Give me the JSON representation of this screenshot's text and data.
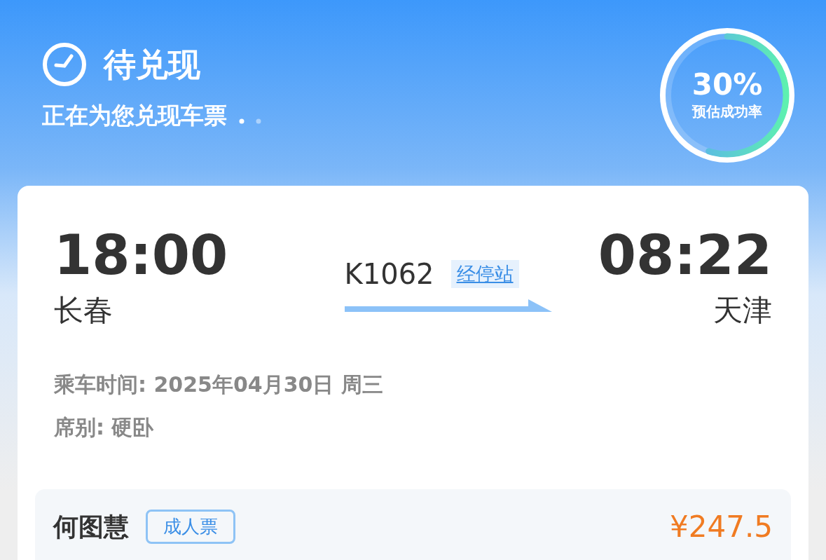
{
  "header": {
    "title": "待兑现",
    "subtitle": "正在为您兑现车票",
    "success_rate": {
      "value": "30%",
      "label": "预估成功率",
      "level": 0.55
    }
  },
  "trip": {
    "departure": {
      "time": "18:00",
      "station": "长春"
    },
    "train": "K1062",
    "stops_link": "经停站",
    "arrival": {
      "time": "08:22",
      "station": "天津"
    },
    "details": [
      {
        "label": "乘车时间:",
        "value": "2025年04月30日 周三"
      },
      {
        "label": "席别:",
        "value": "硬卧"
      }
    ]
  },
  "passenger": {
    "name": "何图慧",
    "ticket_type": "成人票",
    "price": "¥247.5"
  }
}
